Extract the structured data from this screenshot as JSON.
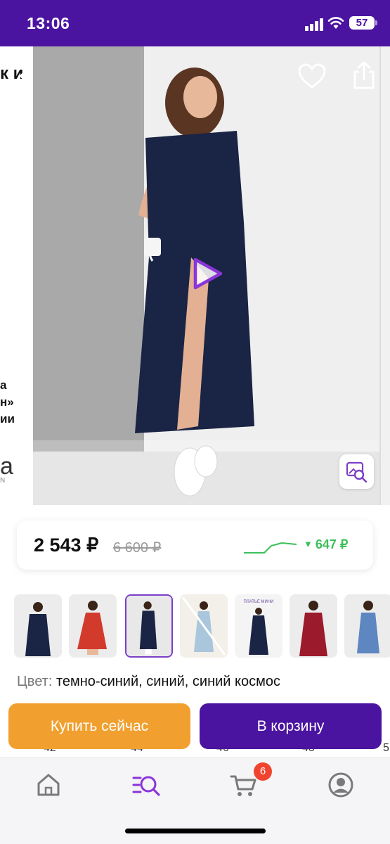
{
  "status_bar": {
    "time": "13:06",
    "battery": "57",
    "background": "#4b14a0"
  },
  "gallery": {
    "prev_slide": {
      "title_fragment": "к и",
      "lines": [
        "а",
        "н»",
        "ии"
      ],
      "logo": "а",
      "logo_sub": "N"
    },
    "icons": [
      "chevron-left-icon",
      "heart-icon",
      "share-icon",
      "play-icon",
      "image-search-icon"
    ]
  },
  "price": {
    "current": "2 543 ₽",
    "old": "6 600 ₽",
    "drop": "647 ₽",
    "drop_color": "#3cbf5a"
  },
  "thumbnails": [
    {
      "dress": "navy",
      "bg": "#ececec"
    },
    {
      "dress": "red",
      "bg": "#ececec"
    },
    {
      "dress": "navy",
      "bg": "#e8e8e8",
      "selected": true
    },
    {
      "dress": "light-blue",
      "bg": "#f3efe9"
    },
    {
      "dress": "navy",
      "bg": "#f4f4f4",
      "caption": "ПЛАТЬЕ МИНИ"
    },
    {
      "dress": "burgundy",
      "bg": "#ececec"
    },
    {
      "dress": "blue",
      "bg": "#ececec"
    }
  ],
  "color": {
    "label": "Цвет:",
    "value": "темно-синий, синий, синий космос"
  },
  "sizes_peek": [
    "42",
    "44",
    "46",
    "48",
    "5"
  ],
  "actions": {
    "buy_now": "Купить сейчас",
    "add_to_cart": "В корзину",
    "buy_color": "#f1a02f",
    "cart_color": "#4b14a0"
  },
  "tab_bar": {
    "items": [
      "home-icon",
      "catalog-search-icon",
      "cart-icon",
      "profile-icon"
    ],
    "cart_badge": "6",
    "active": "catalog-search-icon"
  }
}
